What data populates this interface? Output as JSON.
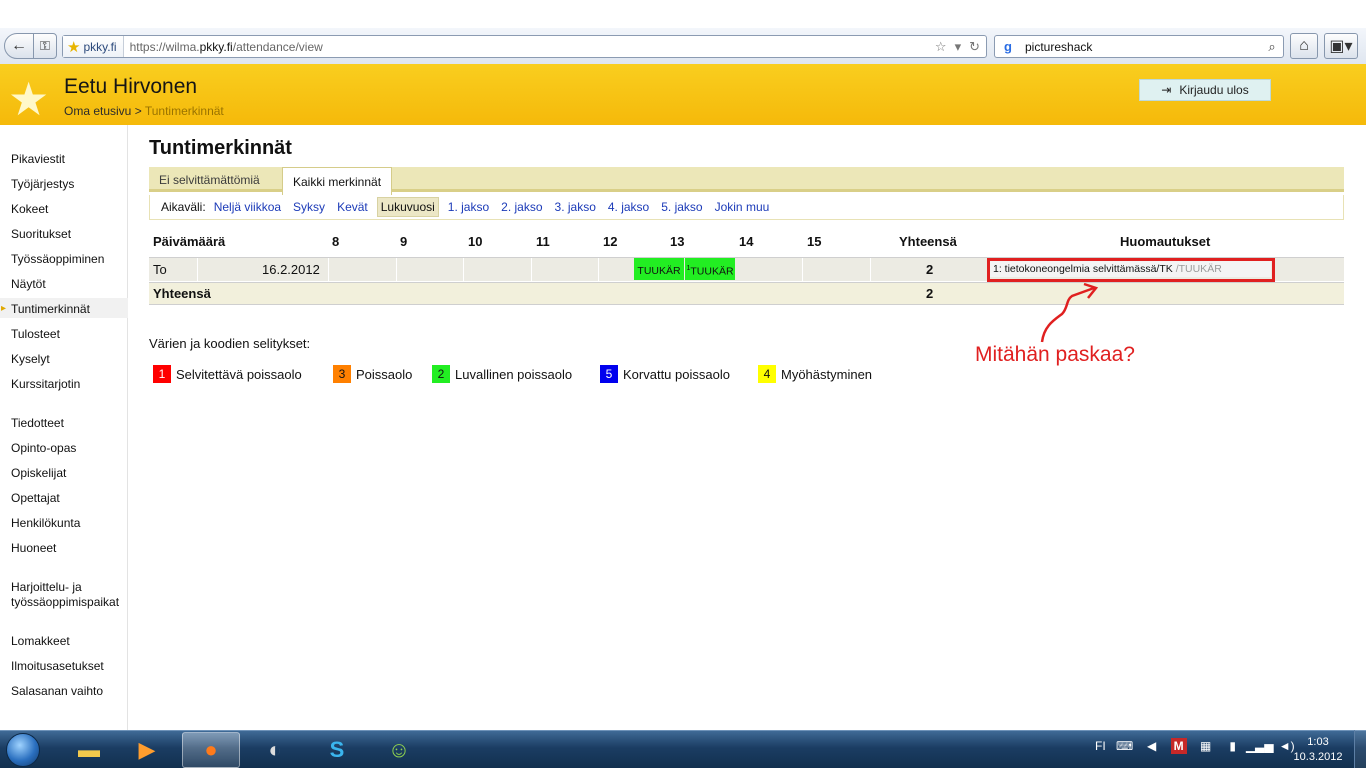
{
  "browser": {
    "site_name": "pkky.fi",
    "url_prefix": "https://wilma.",
    "url_domain": "pkky.fi",
    "url_path": "/attendance/view",
    "search_query": "pictureshack"
  },
  "header": {
    "user_name": "Eetu Hirvonen",
    "breadcrumb_home": "Oma etusivu",
    "breadcrumb_sep": ">",
    "breadcrumb_current": "Tuntimerkinnät",
    "logout_label": "Kirjaudu ulos"
  },
  "sidebar": {
    "items": [
      "Pikaviestit",
      "Työjärjestys",
      "Kokeet",
      "Suoritukset",
      "Työssäoppiminen",
      "Näytöt",
      "Tuntimerkinnät",
      "Tulosteet",
      "Kyselyt",
      "Kurssitarjotin",
      "Tiedotteet",
      "Opinto-opas",
      "Opiskelijat",
      "Opettajat",
      "Henkilökunta",
      "Huoneet",
      "Harjoittelu- ja",
      "työssäoppimispaikat",
      "Lomakkeet",
      "Ilmoitusasetukset",
      "Salasanan vaihto"
    ],
    "active": "Tuntimerkinnät"
  },
  "main": {
    "title": "Tuntimerkinnät",
    "tabs": [
      "Ei selvittämättömiä",
      "Kaikki merkinnät"
    ],
    "period_label": "Aikaväli:",
    "periods": [
      "Neljä viikkoa",
      "Syksy",
      "Kevät",
      "Lukuvuosi",
      "1. jakso",
      "2. jakso",
      "3. jakso",
      "4. jakso",
      "5. jakso",
      "Jokin muu"
    ],
    "selected_period": "Lukuvuosi",
    "table": {
      "headers": [
        "Päivämäärä",
        "8",
        "9",
        "10",
        "11",
        "12",
        "13",
        "14",
        "15",
        "Yhteensä",
        "Huomautukset"
      ],
      "rows": [
        {
          "weekday": "To",
          "date": "16.2.2012",
          "marks": [
            {
              "hour": "12",
              "code": "TUUKÄR"
            },
            {
              "hour": "13",
              "code": "TUUKÄR",
              "prefix": "1"
            }
          ],
          "total": "2",
          "note": "1: tietokoneongelmia selvittämässä/TK",
          "note_suffix": "/TUUKÄR"
        }
      ],
      "sum_label": "Yhteensä",
      "sum_total": "2"
    },
    "legend_title": "Värien ja koodien selitykset:",
    "legend": [
      {
        "code": "1",
        "label": "Selvitettävä poissaolo",
        "color": "#ff0000"
      },
      {
        "code": "3",
        "label": "Poissaolo",
        "color": "#ff8000"
      },
      {
        "code": "2",
        "label": "Luvallinen poissaolo",
        "color": "#22ee22"
      },
      {
        "code": "5",
        "label": "Korvattu poissaolo",
        "color": "#0000ee"
      },
      {
        "code": "4",
        "label": "Myöhästyminen",
        "color": "#ffff00"
      }
    ],
    "annotation": "Mitähän paskaa?"
  },
  "taskbar": {
    "language": "FI",
    "time": "1:03",
    "date": "10.3.2012"
  }
}
